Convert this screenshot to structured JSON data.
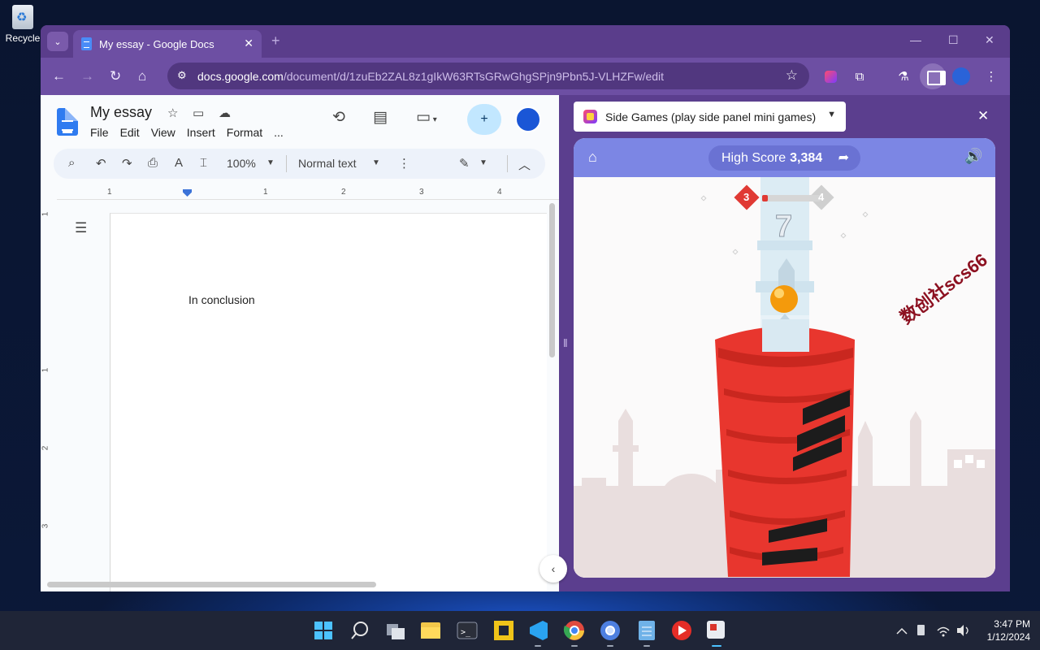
{
  "desktop": {
    "recycle_label": "Recycle"
  },
  "browser": {
    "tab_title": "My essay - Google Docs",
    "url_domain": "docs.google.com",
    "url_path": "/document/d/1zuEb2ZAL8z1gIkW63RTsGRwGhgSPjn9Pbn5J-VLHZFw/edit"
  },
  "docs": {
    "title": "My essay",
    "menu": [
      "File",
      "Edit",
      "View",
      "Insert",
      "Format",
      "..."
    ],
    "zoom": "100%",
    "style": "Normal text",
    "ruler_h": [
      "1",
      "1",
      "2",
      "3",
      "4"
    ],
    "ruler_v": [
      "1",
      "1",
      "2",
      "3"
    ],
    "page_text": "In conclusion"
  },
  "side_panel": {
    "selector_label": "Side Games (play side panel mini games)",
    "high_score_label": "High Score",
    "high_score_value": "3,384",
    "level_current": "3",
    "level_next": "4",
    "level_progress": 0.1,
    "tower_score": "7",
    "watermark": "数创社scs66"
  },
  "taskbar": {
    "time": "3:47 PM",
    "date": "1/12/2024"
  },
  "colors": {
    "browser_frame": "#5a3d8b",
    "game_bar": "#7c86e4",
    "tower_red": "#e8362e",
    "docs_share": "#c2e7ff"
  }
}
